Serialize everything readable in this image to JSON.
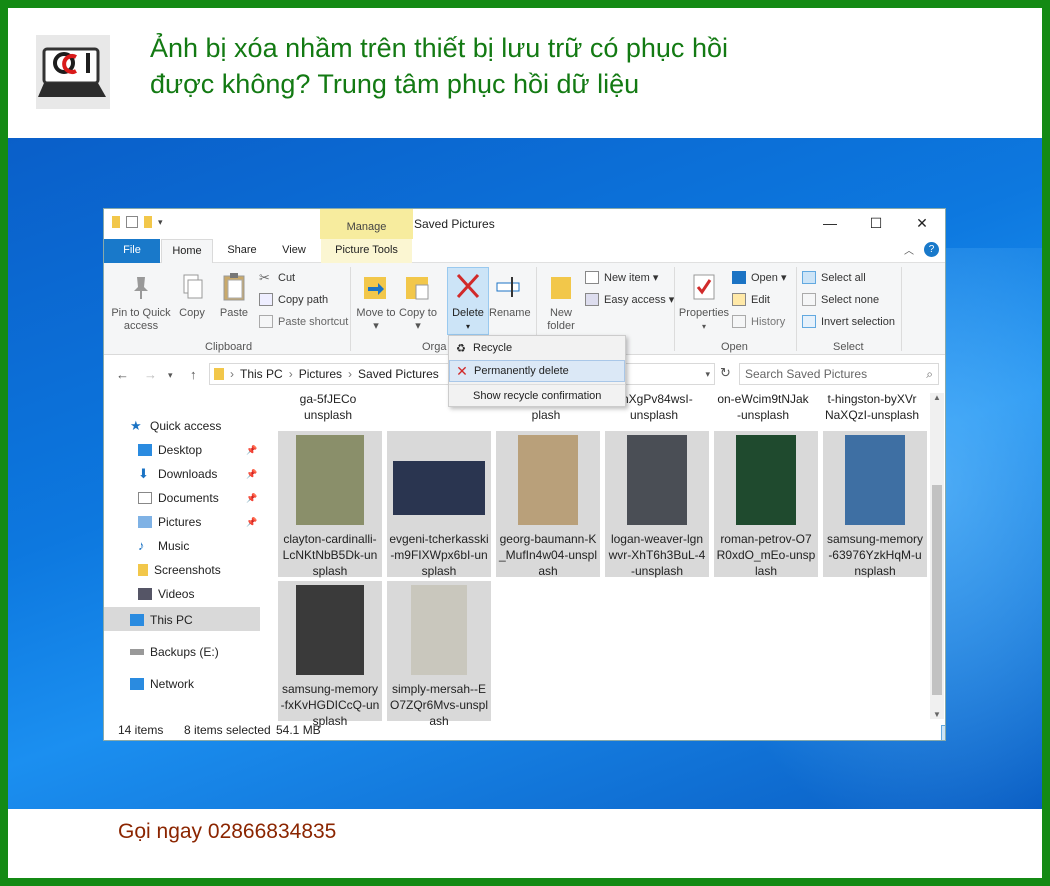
{
  "headline": "Ảnh bị xóa nhầm trên thiết bị lưu trữ có phục hồi được không? Trung tâm phục hồi dữ liệu",
  "call_now": "Gọi ngay 02866834835",
  "window": {
    "manage_tab": "Manage",
    "title": "Saved Pictures",
    "controls": {
      "minimize": "—",
      "maximize": "☐",
      "close": "✕"
    },
    "tabs": {
      "file": "File",
      "home": "Home",
      "share": "Share",
      "view": "View",
      "picture_tools": "Picture Tools"
    },
    "help": "?"
  },
  "ribbon": {
    "clipboard": {
      "pin_label": "Pin to Quick access",
      "copy_label": "Copy",
      "paste_label": "Paste",
      "cut": "Cut",
      "copy_path": "Copy path",
      "paste_shortcut": "Paste shortcut",
      "group": "Clipboard"
    },
    "organize": {
      "move_to": "Move to ▾",
      "copy_to": "Copy to ▾",
      "delete": "Delete",
      "rename": "Rename",
      "group": "Orga"
    },
    "new": {
      "new_folder": "New folder",
      "new_item": "New item ▾",
      "easy_access": "Easy access ▾"
    },
    "open": {
      "properties": "Properties",
      "open": "Open ▾",
      "edit": "Edit",
      "history": "History",
      "group": "Open"
    },
    "select": {
      "select_all": "Select all",
      "select_none": "Select none",
      "invert": "Invert selection",
      "group": "Select"
    }
  },
  "delete_menu": {
    "recycle": "Recycle",
    "permanently_delete": "Permanently delete",
    "show_confirmation": "Show recycle confirmation"
  },
  "address": {
    "crumbs": [
      "This PC",
      "Pictures",
      "Saved Pictures"
    ],
    "search_placeholder": "Search Saved Pictures"
  },
  "nav_pane": {
    "quick_access": "Quick access",
    "items": [
      "Desktop",
      "Downloads",
      "Documents",
      "Pictures",
      "Music",
      "Screenshots",
      "Videos"
    ],
    "this_pc": "This PC",
    "backups": "Backups (E:)",
    "network": "Network"
  },
  "files": {
    "partial_row": [
      {
        "line1": "ga-5fJECo",
        "line2": "unsplash"
      },
      {
        "line1": "",
        "line2": "plash"
      },
      {
        "line1": "qnXgPv84wsI-",
        "line2": "unsplash"
      },
      {
        "line1": "on-eWcim9tNJak",
        "line2": "-unsplash"
      },
      {
        "line1": "t-hingston-byXVr",
        "line2": "NaXQzI-unsplash"
      }
    ],
    "tiles": [
      {
        "name": "clayton-cardinalli-LcNKtNbB5Dk-unsplash",
        "color": "#8a8f6a"
      },
      {
        "name": "evgeni-tcherkasski-m9FIXWpx6bI-unsplash",
        "color": "#2a3550"
      },
      {
        "name": "georg-baumann-K_MufIn4w04-unsplash",
        "color": "#b9a07a"
      },
      {
        "name": "logan-weaver-lgnwvr-XhT6h3BuL-4-unsplash",
        "color": "#4a4e55"
      },
      {
        "name": "roman-petrov-O7R0xdO_mEo-unsplash",
        "color": "#1f4a2e"
      },
      {
        "name": "samsung-memory-63976YzkHqM-unsplash",
        "color": "#3e6fa3"
      },
      {
        "name": "samsung-memory-fxKvHGDICcQ-unsplash",
        "color": "#3a3a3a"
      },
      {
        "name": "simply-mersah--EO7ZQr6Mvs-unsplash",
        "color": "#c9c7bd"
      }
    ]
  },
  "status": {
    "items": "14 items",
    "selected": "8 items selected",
    "size": "54.1 MB"
  }
}
